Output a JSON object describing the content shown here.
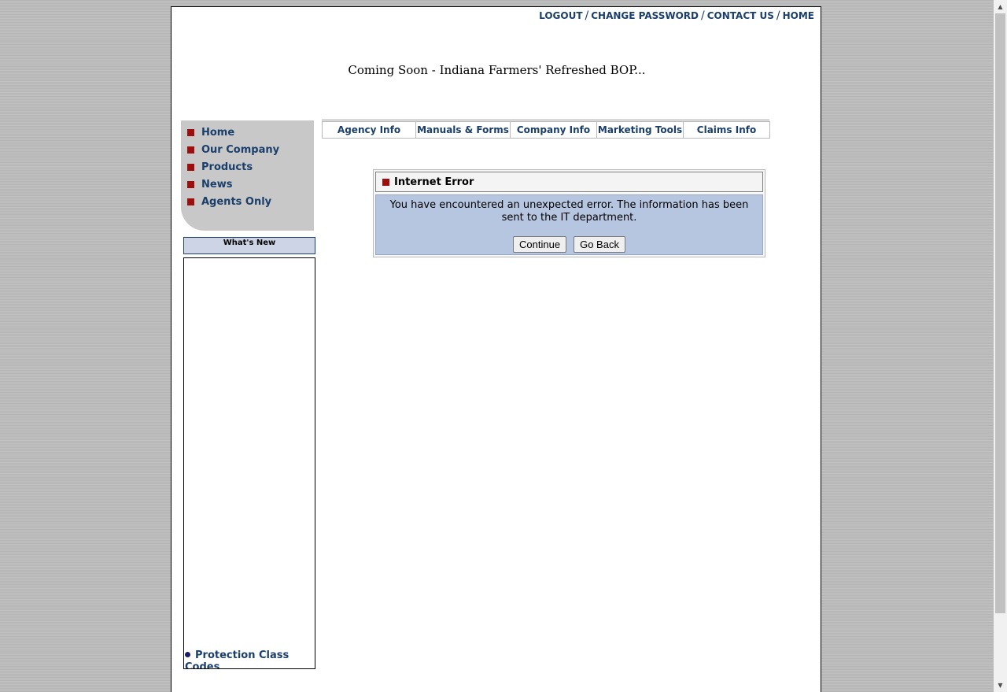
{
  "header": {
    "links": [
      "LOGOUT",
      "CHANGE PASSWORD",
      "CONTACT US",
      "HOME"
    ],
    "separator": "/"
  },
  "banner": {
    "text": "Coming Soon - Indiana Farmers' Refreshed BOP..."
  },
  "sidebar": {
    "items": [
      {
        "label": "Home"
      },
      {
        "label": "Our Company"
      },
      {
        "label": "Products"
      },
      {
        "label": "News"
      },
      {
        "label": "Agents Only"
      }
    ]
  },
  "whats_new": {
    "title": "What's New",
    "items": [
      {
        "label": "Protection Class Codes"
      }
    ]
  },
  "tabs": [
    {
      "label": "Agency Info"
    },
    {
      "label": "Manuals & Forms"
    },
    {
      "label": "Company Info"
    },
    {
      "label": "Marketing Tools"
    },
    {
      "label": "Claims Info"
    }
  ],
  "error_panel": {
    "title": "Internet Error",
    "message": "You have encountered an unexpected error. The information has been sent to the IT department.",
    "continue_label": "Continue",
    "go_back_label": "Go Back"
  },
  "colors": {
    "link_blue": "#1b3f6b",
    "bullet_red": "#9b0f0f",
    "error_body_bg": "#b7c6e0",
    "nav_gray": "#c8c8c8"
  }
}
